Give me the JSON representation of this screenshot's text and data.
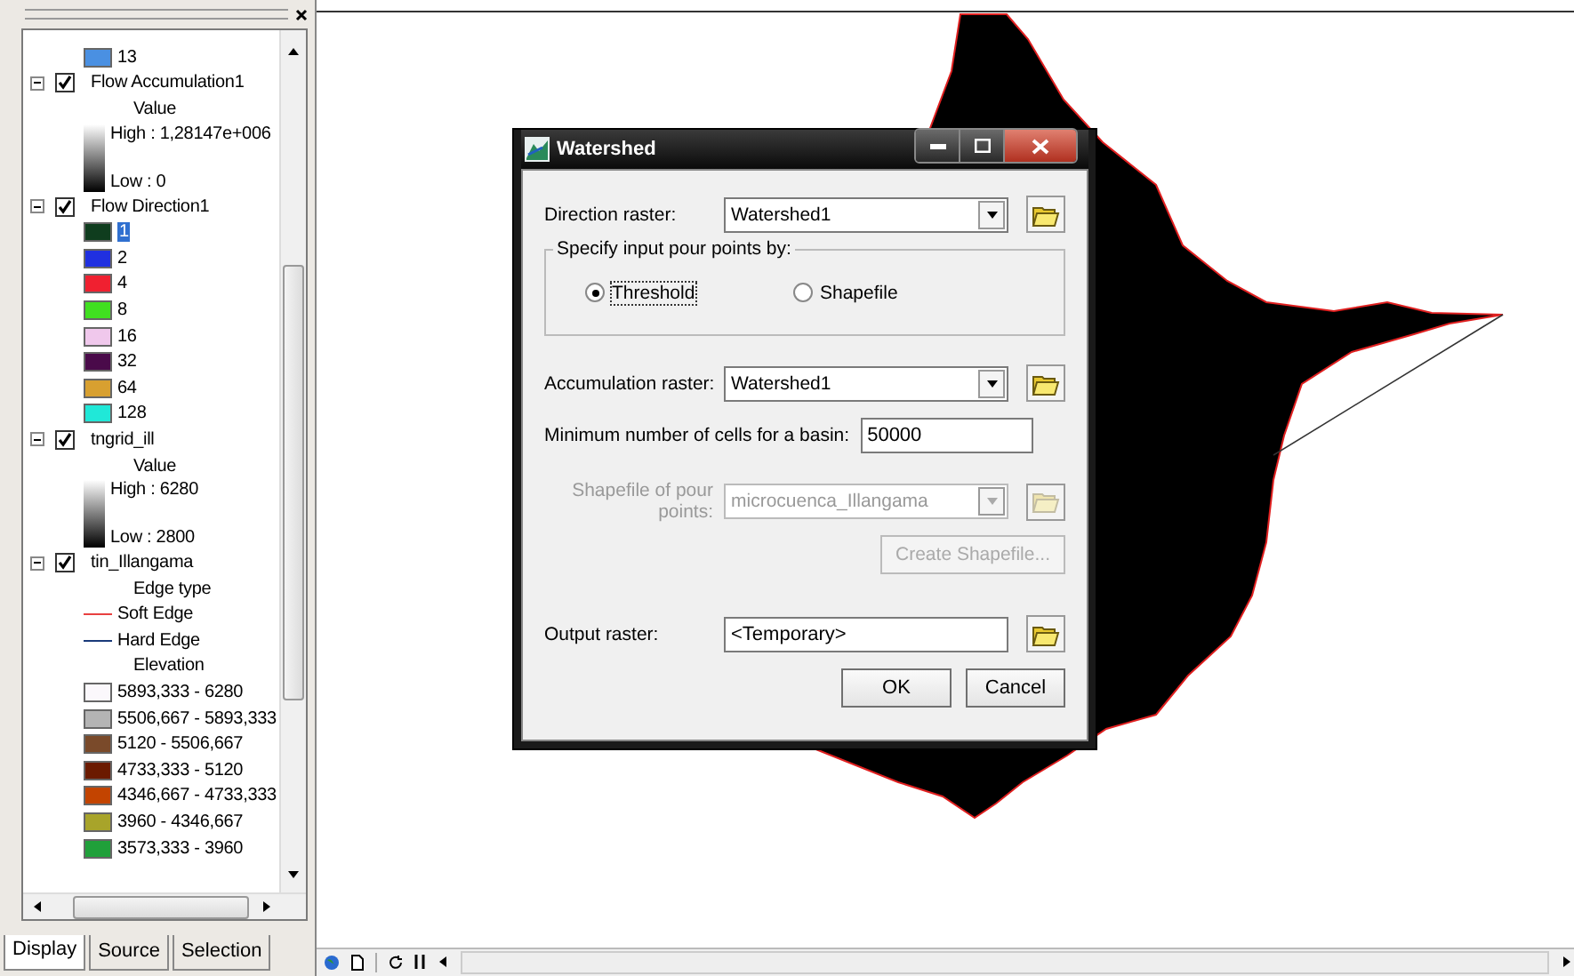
{
  "toc": {
    "top_entries": [
      {
        "kind": "swatch",
        "color": "#4a90e2",
        "label": "13",
        "selected": false
      }
    ],
    "layers": [
      {
        "name": "Flow Accumulation1",
        "checked": true,
        "expanded": true,
        "children": [
          {
            "kind": "heading",
            "label": "Value"
          },
          {
            "kind": "ramp",
            "high": "High : 1,28147e+006",
            "low": "Low : 0"
          }
        ]
      },
      {
        "name": "Flow Direction1",
        "checked": true,
        "expanded": true,
        "children": [
          {
            "kind": "swatch",
            "color": "#0f3d1e",
            "label": "1",
            "selected": true
          },
          {
            "kind": "swatch",
            "color": "#2030e0",
            "label": "2",
            "selected": false
          },
          {
            "kind": "swatch",
            "color": "#f02030",
            "label": "4",
            "selected": false
          },
          {
            "kind": "swatch",
            "color": "#40e020",
            "label": "8",
            "selected": false
          },
          {
            "kind": "swatch",
            "color": "#f0c8ec",
            "label": "16",
            "selected": false
          },
          {
            "kind": "swatch",
            "color": "#4a0a4a",
            "label": "32",
            "selected": false
          },
          {
            "kind": "swatch",
            "color": "#d8a030",
            "label": "64",
            "selected": false
          },
          {
            "kind": "swatch",
            "color": "#20e8d8",
            "label": "128",
            "selected": false
          }
        ]
      },
      {
        "name": "tngrid_ill",
        "checked": true,
        "expanded": true,
        "children": [
          {
            "kind": "heading",
            "label": "Value"
          },
          {
            "kind": "ramp",
            "high": "High : 6280",
            "low": "Low : 2800"
          }
        ]
      },
      {
        "name": "tin_Illangama",
        "checked": true,
        "expanded": true,
        "children": [
          {
            "kind": "heading",
            "label": "Edge type"
          },
          {
            "kind": "line",
            "color": "#e84040",
            "label": "Soft Edge"
          },
          {
            "kind": "line",
            "color": "#1a3a7a",
            "label": "Hard Edge"
          },
          {
            "kind": "heading",
            "label": "Elevation"
          },
          {
            "kind": "swatch",
            "color": "#fbf8fc",
            "label": "5893,333 - 6280",
            "selected": false
          },
          {
            "kind": "swatch",
            "color": "#b4b4b4",
            "label": "5506,667 - 5893,333",
            "selected": false
          },
          {
            "kind": "swatch",
            "color": "#7a4a2a",
            "label": "5120 - 5506,667",
            "selected": false
          },
          {
            "kind": "swatch",
            "color": "#6b1a00",
            "label": "4733,333 - 5120",
            "selected": false
          },
          {
            "kind": "swatch",
            "color": "#c34400",
            "label": "4346,667 - 4733,333",
            "selected": false
          },
          {
            "kind": "swatch",
            "color": "#a8a42a",
            "label": "3960 - 4346,667",
            "selected": false
          },
          {
            "kind": "swatch",
            "color": "#20a03a",
            "label": "3573,333 - 3960",
            "selected": false
          }
        ]
      }
    ],
    "tabs": [
      {
        "label": "Display",
        "selected": true
      },
      {
        "label": "Source",
        "selected": false
      },
      {
        "label": "Selection",
        "selected": false
      }
    ]
  },
  "dialog": {
    "title": "Watershed",
    "direction_raster": {
      "label": "Direction raster:",
      "value": "Watershed1",
      "disabled": false
    },
    "pour_points": {
      "label": "Specify input pour points by:",
      "options": [
        {
          "label": "Threshold",
          "selected": true
        },
        {
          "label": "Shapefile",
          "selected": false
        }
      ]
    },
    "accumulation_raster": {
      "label": "Accumulation raster:",
      "value": "Watershed1",
      "disabled": false
    },
    "min_cells": {
      "label": "Minimum number of cells for a basin:",
      "value": "50000"
    },
    "pour_shapefile": {
      "label": "Shapefile of pour points:",
      "value": "microcuenca_Illangama",
      "disabled": true
    },
    "create_shapefile": {
      "label": "Create Shapefile...",
      "disabled": true
    },
    "output_raster": {
      "label": "Output raster:",
      "value": "<Temporary>"
    },
    "buttons": [
      "OK",
      "Cancel"
    ]
  }
}
